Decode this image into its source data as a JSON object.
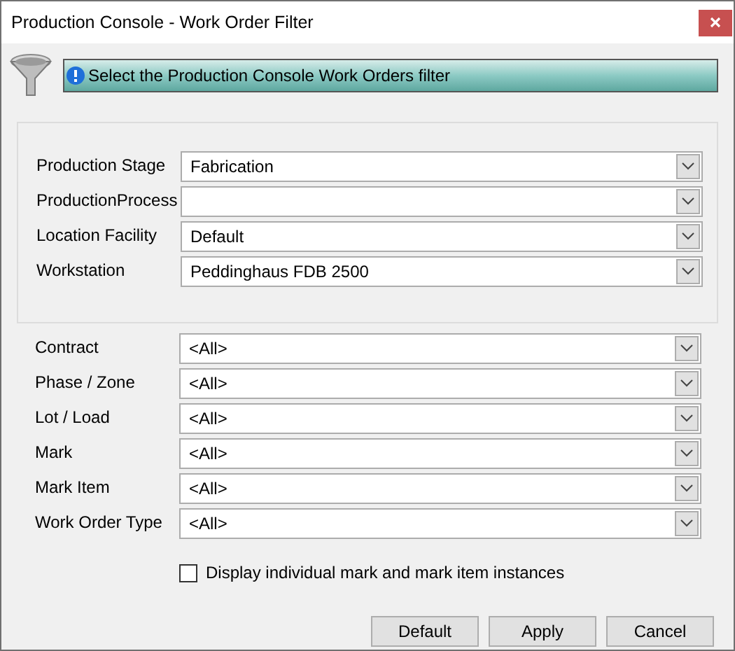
{
  "window": {
    "title": "Production Console - Work Order Filter"
  },
  "banner": {
    "text": "Select the Production Console Work Orders filter"
  },
  "group_fields": [
    {
      "label": "Production Stage",
      "value": "Fabrication"
    },
    {
      "label": "ProductionProcess"
    },
    {
      "label": "Location Facility",
      "value": "Default"
    },
    {
      "label": "Workstation",
      "value": "Peddinghaus FDB 2500"
    }
  ],
  "fields": [
    {
      "label": "Contract",
      "value": "<All>"
    },
    {
      "label": "Phase / Zone",
      "value": "<All>"
    },
    {
      "label": "Lot / Load",
      "value": "<All>"
    },
    {
      "label": "Mark",
      "value": "<All>"
    },
    {
      "label": "Mark Item",
      "value": "<All>"
    },
    {
      "label": "Work Order Type",
      "value": "<All>"
    }
  ],
  "checkbox": {
    "label": "Display individual mark and mark item instances",
    "checked": false
  },
  "buttons": [
    "Default",
    "Apply",
    "Cancel"
  ]
}
